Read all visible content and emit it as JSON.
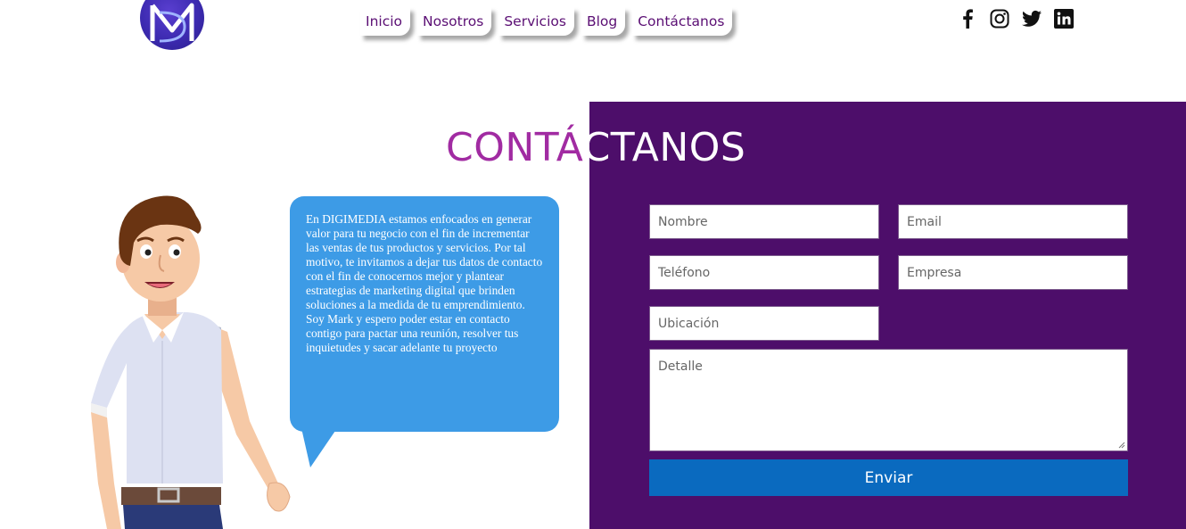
{
  "brand": {
    "logo_letters": "DM"
  },
  "nav": {
    "items": [
      {
        "label": "Inicio"
      },
      {
        "label": "Nosotros"
      },
      {
        "label": "Servicios"
      },
      {
        "label": "Blog"
      },
      {
        "label": "Contáctanos"
      }
    ]
  },
  "social": {
    "icons": [
      "facebook-icon",
      "instagram-icon",
      "twitter-icon",
      "linkedin-icon"
    ]
  },
  "section": {
    "heading_left": "CONTÁ",
    "heading_right": "CTANOS"
  },
  "bubble": {
    "text": "En DIGIMEDIA estamos enfocados en generar valor para tu negocio con el fin de incrementar las ventas de tus productos y servicios. Por tal motivo, te invitamos a dejar tus datos de contacto con el fin de conocernos mejor y plantear estrategias de marketing digital que brinden soluciones a la medida de tu emprendimiento. Soy Mark y espero poder estar en contacto contigo para pactar una reunión, resolver tus inquietudes y sacar adelante tu proyecto"
  },
  "form": {
    "nombre_placeholder": "Nombre",
    "email_placeholder": "Email",
    "telefono_placeholder": "Teléfono",
    "empresa_placeholder": "Empresa",
    "ubicacion_placeholder": "Ubicación",
    "detalle_placeholder": "Detalle",
    "submit_label": "Enviar"
  },
  "colors": {
    "panel": "#4d0e6a",
    "heading_accent": "#a12ba2",
    "bubble": "#3d9be6",
    "button": "#0a6abf",
    "nav_text": "#5b0f74"
  }
}
